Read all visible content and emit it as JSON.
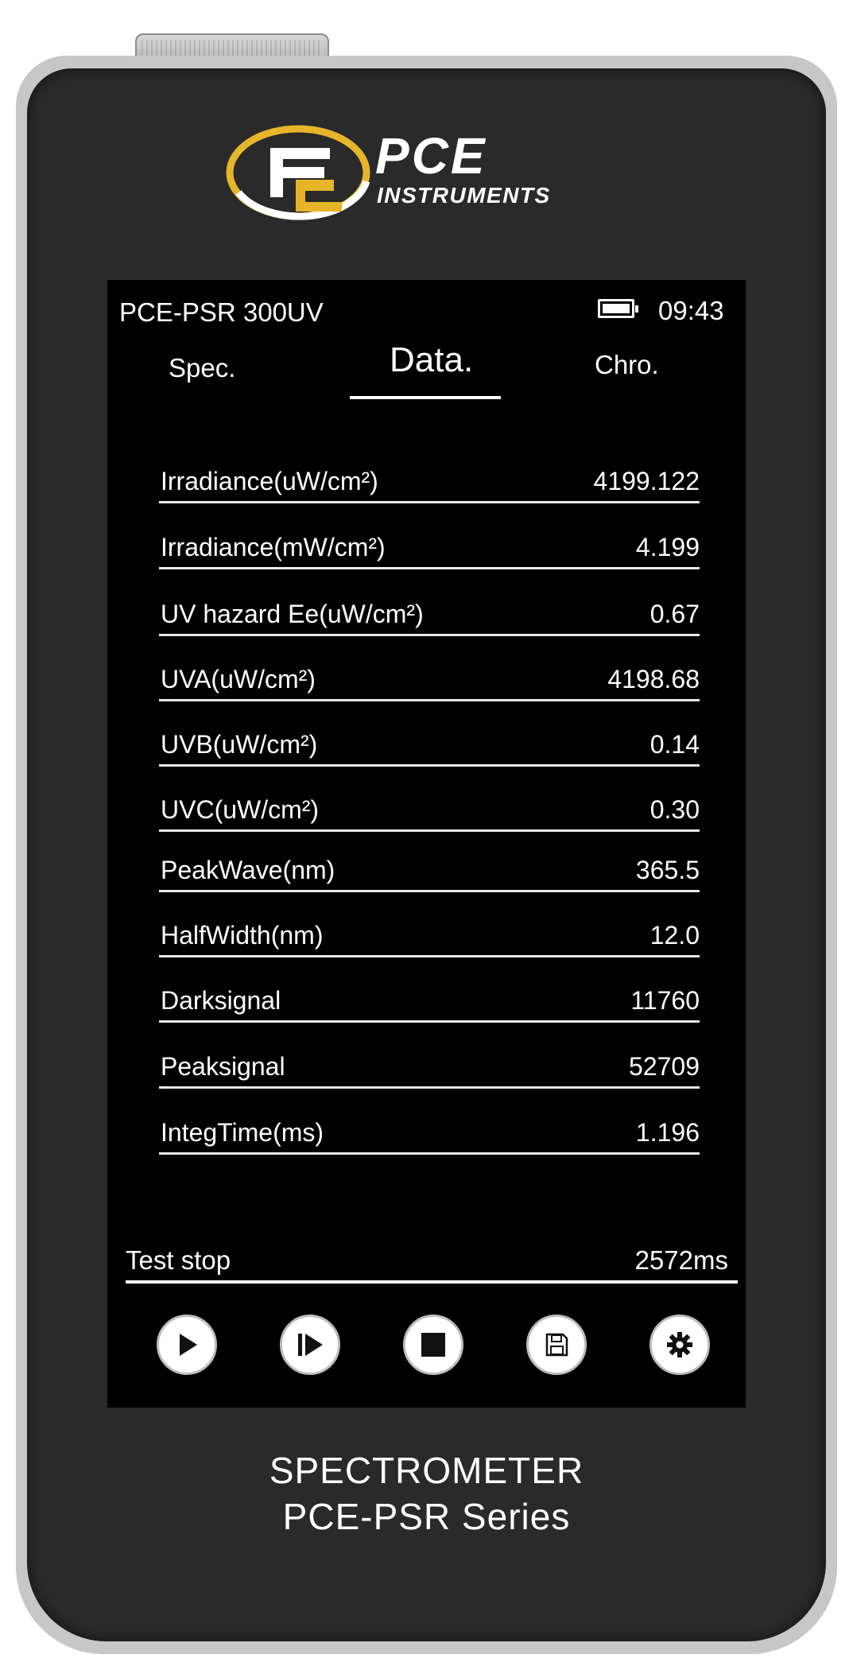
{
  "brand": {
    "name": "PCE",
    "subtitle": "INSTRUMENTS",
    "logo_colors": {
      "ring": "#e6b52a",
      "mark": "#ffffff"
    }
  },
  "screen": {
    "model": "PCE-PSR 300UV",
    "battery_level": 1.0,
    "clock": "09:43",
    "tabs": [
      {
        "label": "Spec.",
        "active": false
      },
      {
        "label": "Data.",
        "active": true
      },
      {
        "label": "Chro.",
        "active": false
      }
    ],
    "rows": [
      {
        "label": "Irradiance(uW/cm²)",
        "value": "4199.122"
      },
      {
        "label": "Irradiance(mW/cm²)",
        "value": "4.199"
      },
      {
        "label": "UV hazard Ee(uW/cm²)",
        "value": "0.67"
      },
      {
        "label": "UVA(uW/cm²)",
        "value": "4198.68"
      },
      {
        "label": "UVB(uW/cm²)",
        "value": "0.14"
      },
      {
        "label": "UVC(uW/cm²)",
        "value": "0.30"
      },
      {
        "label": "PeakWave(nm)",
        "value": "365.5"
      },
      {
        "label": "HalfWidth(nm)",
        "value": "12.0"
      },
      {
        "label": "Darksignal",
        "value": "11760"
      },
      {
        "label": "Peaksignal",
        "value": "52709"
      },
      {
        "label": "IntegTime(ms)",
        "value": "1.196"
      }
    ],
    "status": {
      "text": "Test stop",
      "time": "2572ms"
    },
    "buttons": [
      {
        "icon": "play-icon"
      },
      {
        "icon": "step-play-icon"
      },
      {
        "icon": "stop-icon"
      },
      {
        "icon": "save-icon"
      },
      {
        "icon": "gear-icon"
      }
    ]
  },
  "device": {
    "title_line1": "SPECTROMETER",
    "title_line2": "PCE-PSR Series"
  },
  "colors": {
    "screen_bg": "#000000",
    "device_body": "#2a2a2a",
    "device_frame": "#c7c7c7",
    "text": "#ffffff"
  }
}
